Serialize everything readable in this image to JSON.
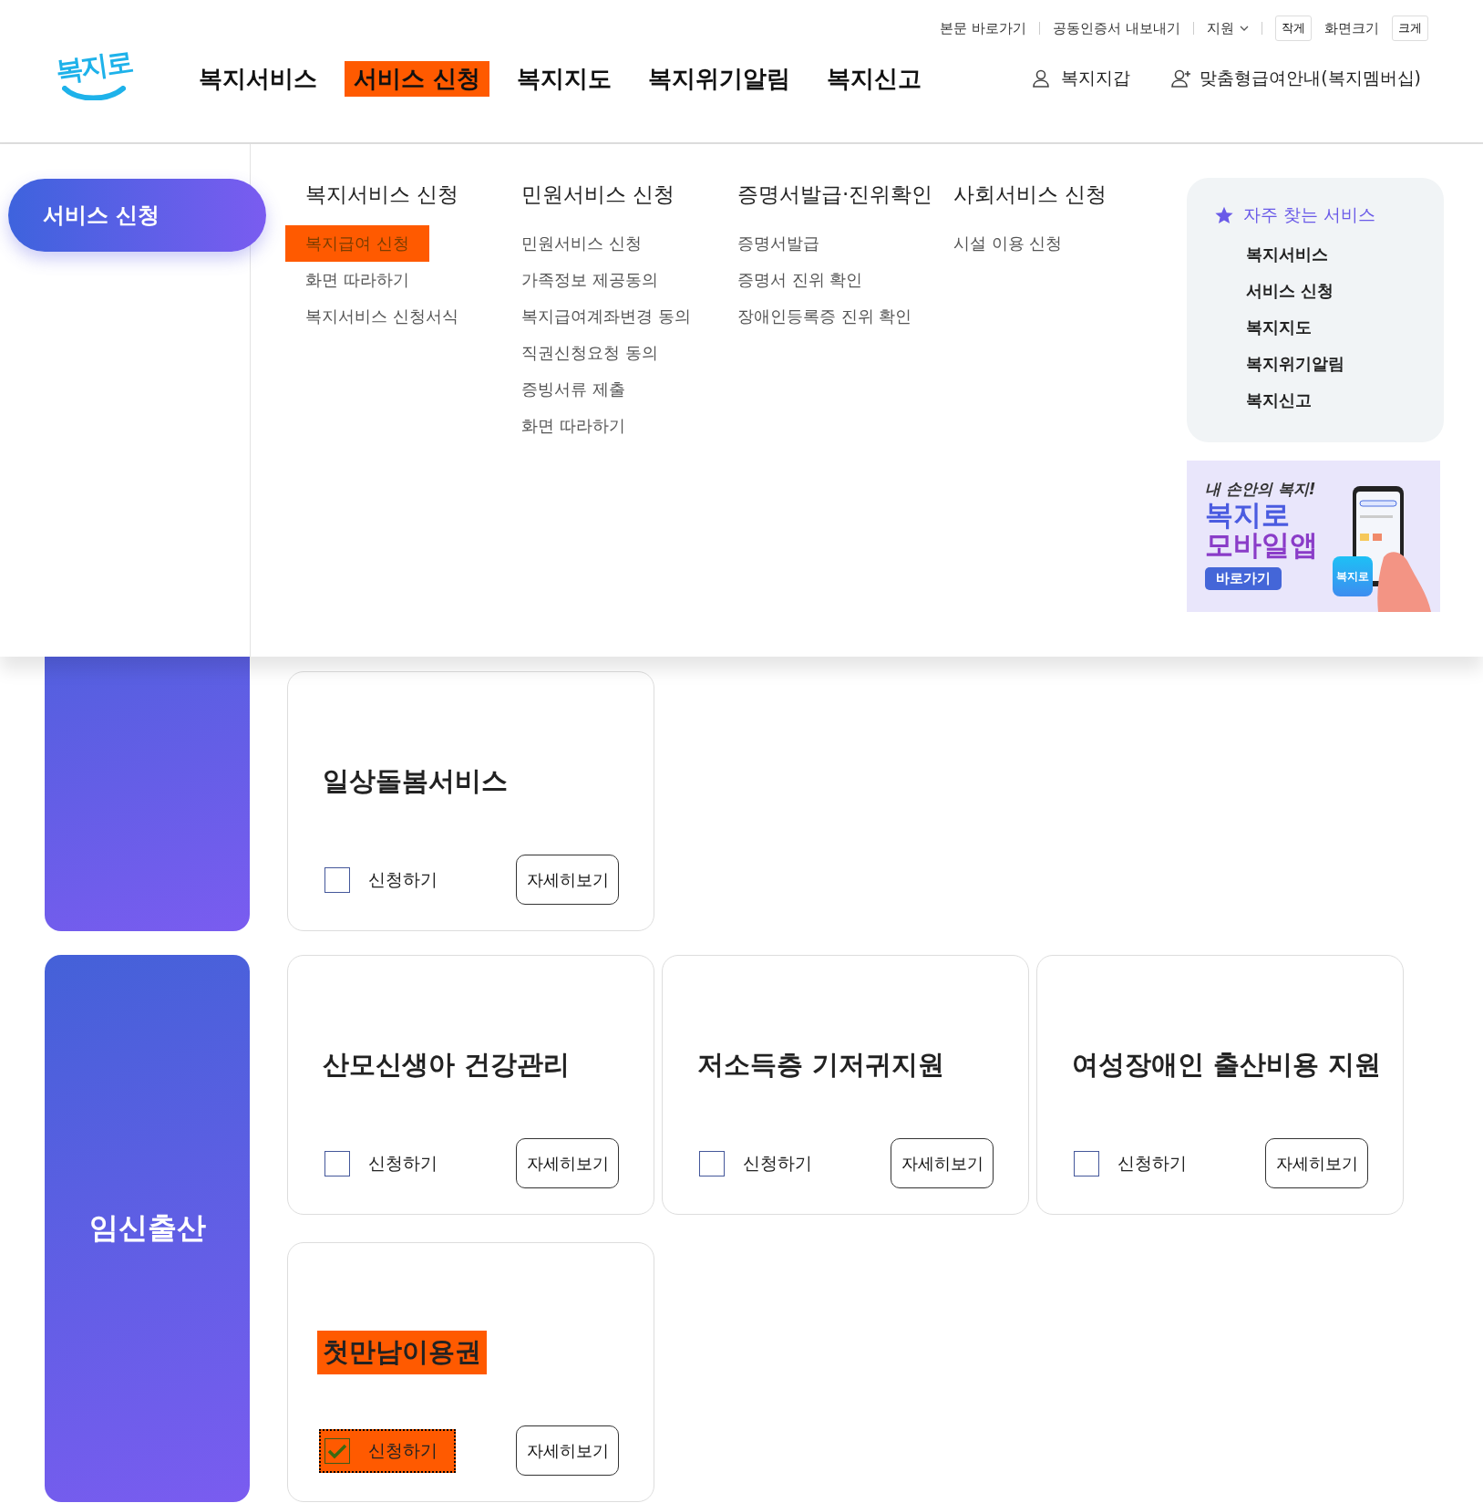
{
  "utility": {
    "links": [
      "본문 바로가기",
      "공동인증서 내보내기"
    ],
    "language": "지원",
    "font_size": {
      "smaller": "작게",
      "label": "화면크기",
      "larger": "크게"
    }
  },
  "logo": "복지로",
  "nav": [
    {
      "label": "복지서비스",
      "highlighted": false
    },
    {
      "label": "서비스 신청",
      "highlighted": true
    },
    {
      "label": "복지지도",
      "highlighted": false
    },
    {
      "label": "복지위기알림",
      "highlighted": false
    },
    {
      "label": "복지신고",
      "highlighted": false
    }
  ],
  "user_links": [
    {
      "label": "복지지갑",
      "kind": "person"
    },
    {
      "label": "맞춤형급여안내(복지멤버십)",
      "kind": "person-add"
    }
  ],
  "mega_menu": {
    "active_section": "서비스 신청",
    "columns": [
      {
        "title": "복지서비스 신청",
        "items": [
          {
            "label": "복지급여 신청",
            "highlighted": true
          },
          {
            "label": "화면 따라하기",
            "highlighted": false
          },
          {
            "label": "복지서비스 신청서식",
            "highlighted": false
          }
        ]
      },
      {
        "title": "민원서비스 신청",
        "items": [
          {
            "label": "민원서비스 신청",
            "highlighted": false
          },
          {
            "label": "가족정보 제공동의",
            "highlighted": false
          },
          {
            "label": "복지급여계좌변경 동의",
            "highlighted": false
          },
          {
            "label": "직권신청요청 동의",
            "highlighted": false
          },
          {
            "label": "증빙서류 제출",
            "highlighted": false
          },
          {
            "label": "화면 따라하기",
            "highlighted": false
          }
        ]
      },
      {
        "title": "증명서발급·진위확인",
        "items": [
          {
            "label": "증명서발급",
            "highlighted": false
          },
          {
            "label": "증명서 진위 확인",
            "highlighted": false
          },
          {
            "label": "장애인등록증 진위 확인",
            "highlighted": false
          }
        ]
      },
      {
        "title": "사회서비스 신청",
        "items": [
          {
            "label": "시설 이용 신청",
            "highlighted": false
          }
        ]
      }
    ],
    "favorites": {
      "title": "자주 찾는 서비스",
      "items": [
        "복지서비스",
        "서비스 신청",
        "복지지도",
        "복지위기알림",
        "복지신고"
      ]
    },
    "banner": {
      "tagline": "내 손안의 복지!",
      "title_lines": [
        "복지로",
        "모바일앱"
      ],
      "button": "바로가기",
      "app_icon": "복지로"
    }
  },
  "groups": [
    {
      "cards": [
        {
          "title": "일상돌봄서비스",
          "title_highlighted": false,
          "checkbox_label": "신청하기",
          "checked": false,
          "focused": false,
          "checkbox_highlighted": false,
          "details_button": "자세히보기"
        }
      ]
    },
    {
      "category": "임신출산",
      "cards": [
        {
          "title": "산모신생아 건강관리",
          "title_highlighted": false,
          "checkbox_label": "신청하기",
          "checked": false,
          "focused": false,
          "checkbox_highlighted": false,
          "details_button": "자세히보기"
        },
        {
          "title": "저소득층 기저귀지원",
          "title_highlighted": false,
          "checkbox_label": "신청하기",
          "checked": false,
          "focused": false,
          "checkbox_highlighted": false,
          "details_button": "자세히보기"
        },
        {
          "title": "여성장애인 출산비용 지원",
          "title_highlighted": false,
          "checkbox_label": "신청하기",
          "checked": false,
          "focused": false,
          "checkbox_highlighted": false,
          "details_button": "자세히보기"
        },
        {
          "title": "첫만남이용권",
          "title_highlighted": true,
          "checkbox_label": "신청하기",
          "checked": true,
          "focused": true,
          "checkbox_highlighted": true,
          "details_button": "자세히보기"
        }
      ]
    }
  ]
}
